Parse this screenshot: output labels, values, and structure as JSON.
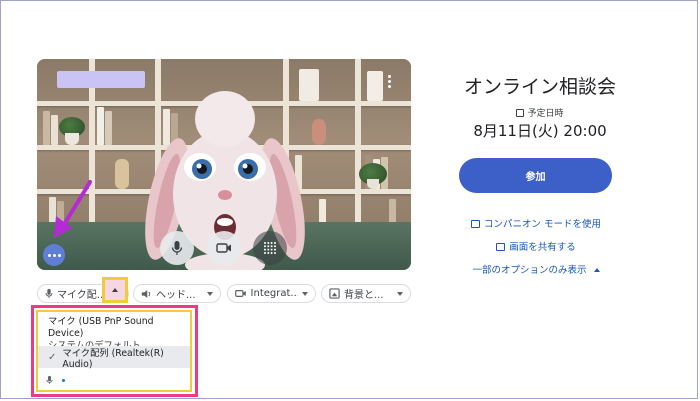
{
  "meeting": {
    "title": "オンライン相談会",
    "schedule_label": "予定日時",
    "datetime": "8月11日(火) 20:00",
    "join_label": "参加",
    "companion_label": "コンパニオン モードを使用",
    "share_label": "画面を共有する",
    "options_label": "一部のオプションのみ表示"
  },
  "devices": {
    "mic_label": "マイク配...",
    "speaker_label": "ヘッド...",
    "camera_label": "Integrat...",
    "background_label": "背景と..."
  },
  "mic_dropdown": {
    "options": [
      {
        "line1": "マイク (USB PnP Sound Device)",
        "line2": "システムのデフォルト"
      },
      {
        "line1": "マイク配列 (Realtek(R) Audio)",
        "selected": true
      }
    ],
    "check_mark": "✓"
  },
  "colors": {
    "accent": "#3c5fc8",
    "link": "#1a57b8",
    "highlight_pink": "#ea3a8a",
    "highlight_yellow": "#f1cc3a"
  }
}
